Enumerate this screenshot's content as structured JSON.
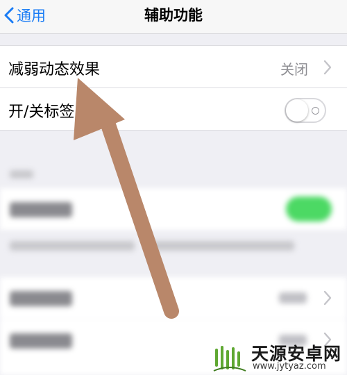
{
  "nav": {
    "back_label": "通用",
    "title": "辅助功能"
  },
  "rows": {
    "reduce_motion": {
      "label": "减弱动态效果",
      "value": "关闭"
    },
    "onoff_labels": {
      "label": "开/关标签",
      "toggle_on": false
    }
  },
  "watermark": {
    "name": "天源安卓网",
    "url": "www.jytyaz.com"
  },
  "colors": {
    "accent": "#1a7cf5",
    "arrow": "#b9876a",
    "toggle_on": "#4cd964"
  }
}
